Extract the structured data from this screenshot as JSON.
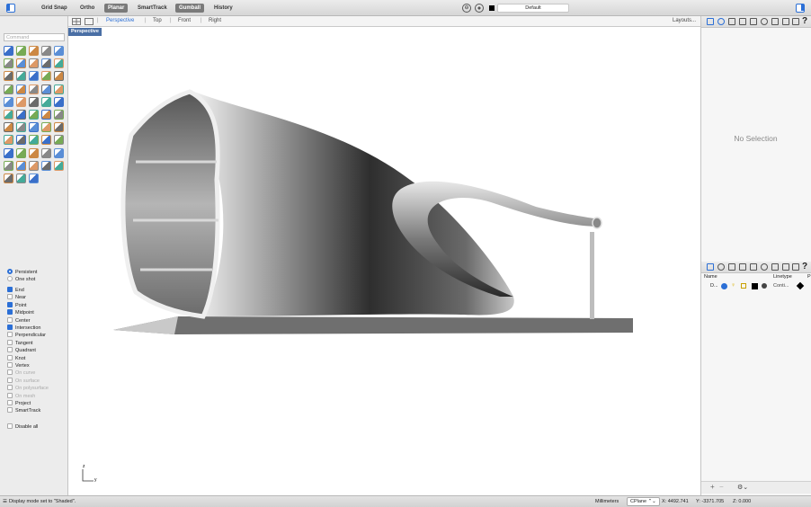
{
  "toolbar": {
    "items": [
      "Grid Snap",
      "Ortho",
      "Planar",
      "SmartTrack",
      "Gumball",
      "History"
    ],
    "active_items": [
      "Planar",
      "Gumball"
    ],
    "layer_default": "Default"
  },
  "viewport_tabs": {
    "tabs": [
      "Perspective",
      "Top",
      "Front",
      "Right"
    ],
    "active": "Perspective",
    "layouts": "Layouts..."
  },
  "viewport": {
    "label": "Perspective",
    "axis_z": "z",
    "axis_y": "y"
  },
  "command": {
    "placeholder": "Command"
  },
  "osnap": {
    "modes": [
      {
        "label": "Persistent",
        "type": "radio",
        "selected": true
      },
      {
        "label": "One shot",
        "type": "radio",
        "selected": false
      }
    ],
    "items": [
      {
        "label": "End",
        "checked": true,
        "enabled": true
      },
      {
        "label": "Near",
        "checked": false,
        "enabled": true
      },
      {
        "label": "Point",
        "checked": true,
        "enabled": true
      },
      {
        "label": "Midpoint",
        "checked": true,
        "enabled": true
      },
      {
        "label": "Center",
        "checked": false,
        "enabled": true
      },
      {
        "label": "Intersection",
        "checked": true,
        "enabled": true
      },
      {
        "label": "Perpendicular",
        "checked": false,
        "enabled": true
      },
      {
        "label": "Tangent",
        "checked": false,
        "enabled": true
      },
      {
        "label": "Quadrant",
        "checked": false,
        "enabled": true
      },
      {
        "label": "Knot",
        "checked": false,
        "enabled": true
      },
      {
        "label": "Vertex",
        "checked": false,
        "enabled": true
      },
      {
        "label": "On curve",
        "checked": false,
        "enabled": false
      },
      {
        "label": "On surface",
        "checked": false,
        "enabled": false
      },
      {
        "label": "On polysurface",
        "checked": false,
        "enabled": false
      },
      {
        "label": "On mesh",
        "checked": false,
        "enabled": false
      },
      {
        "label": "Project",
        "checked": false,
        "enabled": true
      },
      {
        "label": "SmartTrack",
        "checked": false,
        "enabled": true
      }
    ],
    "disable_all": "Disable all"
  },
  "properties": {
    "empty_text": "No Selection"
  },
  "layers": {
    "col_name": "Name",
    "col_linetype": "Linetype",
    "col_p": "P",
    "row_name": "D...",
    "row_linetype": "Conti..."
  },
  "status": {
    "message": "Display mode set to \"Shaded\".",
    "units": "Millimeters",
    "cplane": "CPlane",
    "x": "X: 4492.741",
    "y": "Y: -3371.705",
    "z": "Z: 0.000"
  },
  "colors": {
    "accent": "#2b6fd6",
    "viewport_label_bg": "#4a6fa5"
  }
}
